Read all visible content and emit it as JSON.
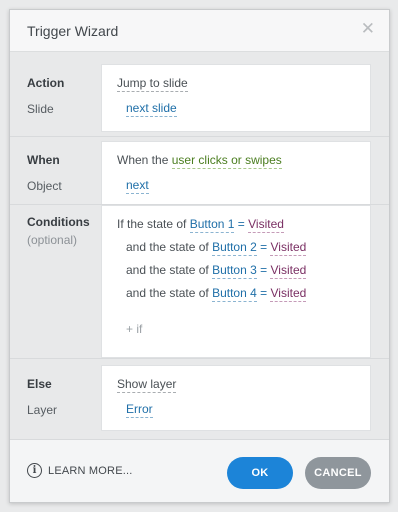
{
  "dialog": {
    "title": "Trigger Wizard",
    "close_glyph": "✕"
  },
  "action": {
    "label": "Action",
    "value": "Jump to slide",
    "sub_label": "Slide",
    "sub_value": "next slide"
  },
  "when": {
    "label": "When",
    "prefix": "When the",
    "value": "user clicks or swipes",
    "sub_label": "Object",
    "sub_value": "next"
  },
  "conditions": {
    "label": "Conditions",
    "hint": "(optional)",
    "rows": [
      {
        "prefix": "If the state of",
        "object": "Button 1",
        "op": "=",
        "state": "Visited"
      },
      {
        "prefix": "and the state of",
        "object": "Button 2",
        "op": "=",
        "state": "Visited"
      },
      {
        "prefix": "and the state of",
        "object": "Button 3",
        "op": "=",
        "state": "Visited"
      },
      {
        "prefix": "and the state of",
        "object": "Button 4",
        "op": "=",
        "state": "Visited"
      }
    ],
    "add_label": "+ if"
  },
  "else": {
    "label": "Else",
    "value": "Show layer",
    "sub_label": "Layer",
    "sub_value": "Error"
  },
  "footer": {
    "info_glyph": "i",
    "learn_more": "LEARN MORE...",
    "ok_label": "OK",
    "cancel_label": "CANCEL"
  },
  "colors": {
    "ok_button": "#1c84d8",
    "cancel_button": "#8f969c",
    "link_blue": "#1f6fa8",
    "link_green": "#4a7d1f",
    "link_purple": "#7a2f63"
  },
  "icons": {
    "close": "close-icon",
    "info": "info-icon"
  }
}
